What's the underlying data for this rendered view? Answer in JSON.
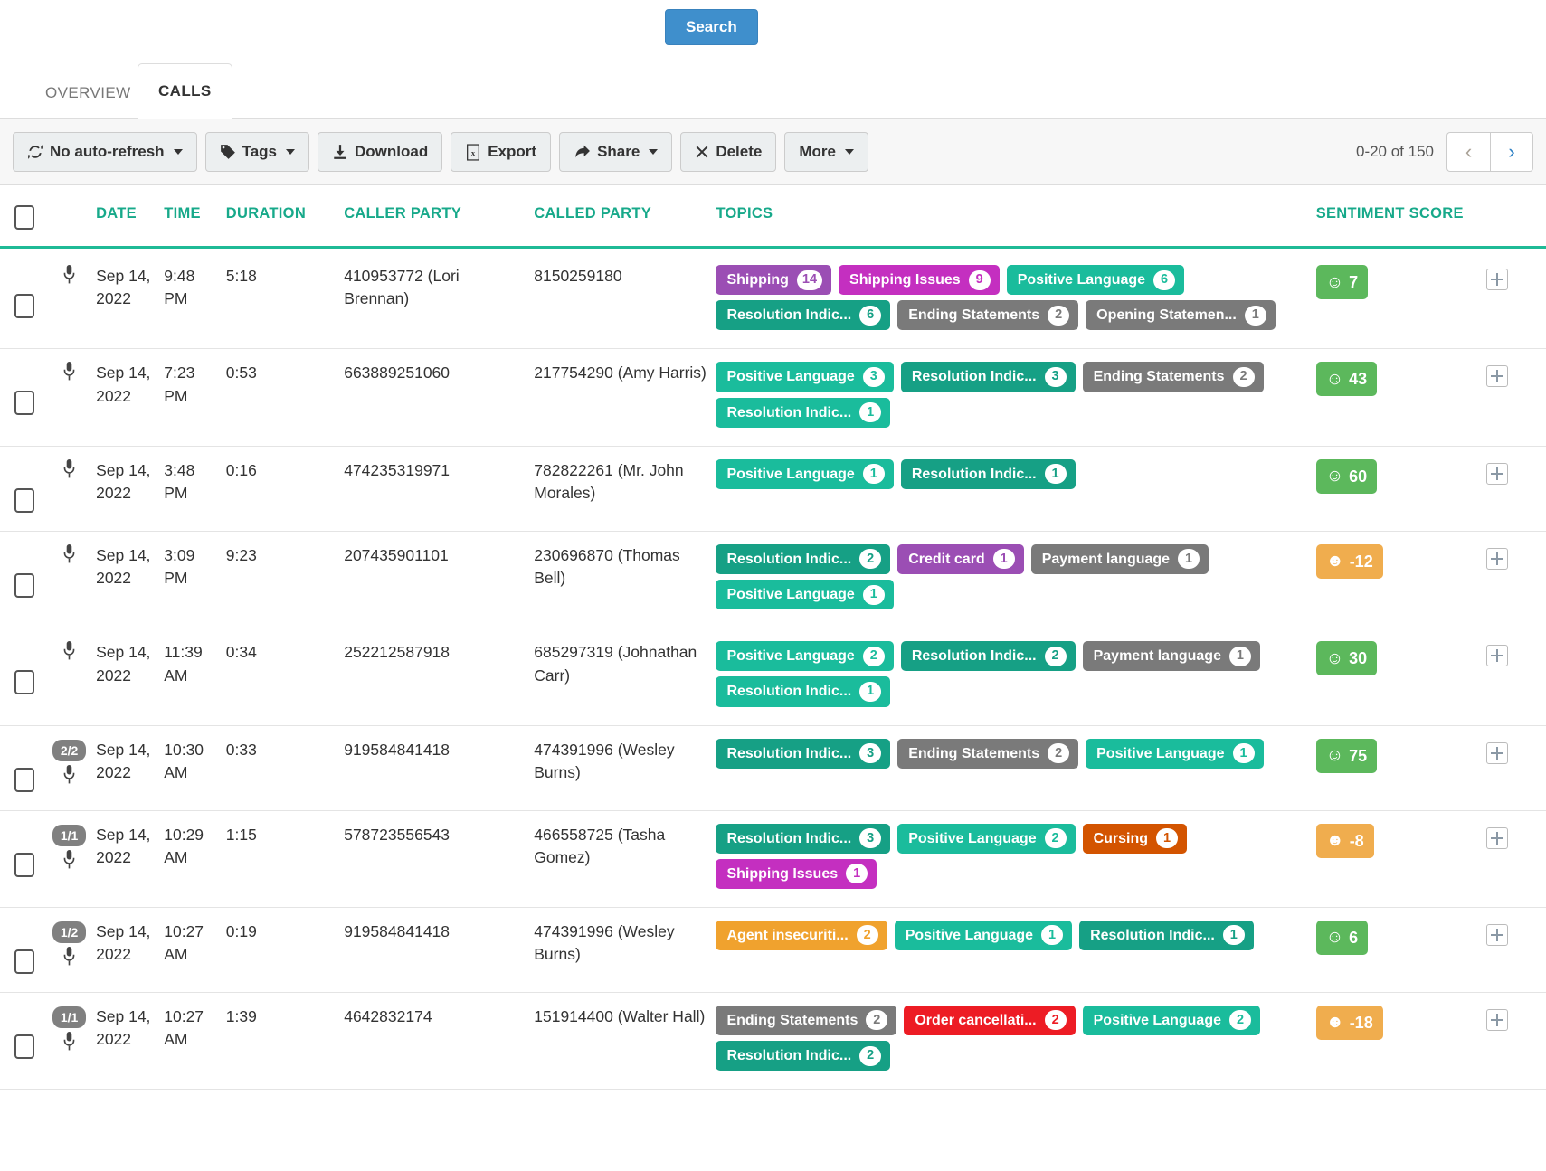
{
  "search": {
    "label": "Search"
  },
  "tabs": [
    {
      "label": "OVERVIEW",
      "active": false
    },
    {
      "label": "CALLS",
      "active": true
    }
  ],
  "toolbar": {
    "buttons": [
      {
        "label": "No auto-refresh",
        "icon": "refresh-icon",
        "caret": true
      },
      {
        "label": "Tags",
        "icon": "tag-icon",
        "caret": true
      },
      {
        "label": "Download",
        "icon": "download-icon",
        "caret": false
      },
      {
        "label": "Export",
        "icon": "spreadsheet-icon",
        "caret": false
      },
      {
        "label": "Share",
        "icon": "share-icon",
        "caret": true
      },
      {
        "label": "Delete",
        "icon": "close-icon",
        "caret": false
      },
      {
        "label": "More",
        "icon": "",
        "caret": true
      }
    ],
    "pagination": {
      "range": "0-20 of 150",
      "prev_icon": "chevron-left-icon",
      "next_icon": "chevron-right-icon"
    }
  },
  "table": {
    "columns": [
      "",
      "",
      "DATE",
      "TIME",
      "DURATION",
      "CALLER PARTY",
      "CALLED PARTY",
      "TOPICS",
      "SENTIMENT SCORE",
      ""
    ],
    "colors": {
      "header": "#17a98a",
      "header_rule": "#1fba96",
      "tag_teal_light": "#1abc9c",
      "tag_teal_dark": "#16a085",
      "tag_gray": "#7a7a7a",
      "tag_purple": "#9b4eb4",
      "tag_magenta": "#c42fc0",
      "tag_orange": "#f0a22e",
      "tag_dark_orange": "#d35400",
      "tag_red": "#ed1c24",
      "sentiment_positive": "#5cb85c",
      "sentiment_negative": "#f0ad4e"
    },
    "rows": [
      {
        "channels": "",
        "mic": "microphone-icon",
        "date": "Sep 14, 2022",
        "time": "9:48 PM",
        "duration": "5:18",
        "caller_party": "410953772 (Lori Brennan)",
        "called_party": "8150259180",
        "topics": [
          {
            "label": "Shipping",
            "count": "14",
            "color": "#9b4eb4",
            "count_color": "#9b4eb4"
          },
          {
            "label": "Shipping Issues",
            "count": "9",
            "color": "#c42fc0",
            "count_color": "#c42fc0"
          },
          {
            "label": "Positive Language",
            "count": "6",
            "color": "#1abc9c",
            "count_color": "#1abc9c"
          },
          {
            "label": "Resolution Indic...",
            "count": "6",
            "color": "#16a085",
            "count_color": "#16a085"
          },
          {
            "label": "Ending Statements",
            "count": "2",
            "color": "#7a7a7a",
            "count_color": "#7a7a7a"
          },
          {
            "label": "Opening Statemen...",
            "count": "1",
            "color": "#7a7a7a",
            "count_color": "#7a7a7a"
          }
        ],
        "sentiment": {
          "value": "7",
          "face": "☺",
          "color": "#5cb85c"
        }
      },
      {
        "channels": "",
        "mic": "microphone-icon",
        "date": "Sep 14, 2022",
        "time": "7:23 PM",
        "duration": "0:53",
        "caller_party": "663889251060",
        "called_party": "217754290 (Amy Harris)",
        "topics": [
          {
            "label": "Positive Language",
            "count": "3",
            "color": "#1abc9c",
            "count_color": "#1abc9c"
          },
          {
            "label": "Resolution Indic...",
            "count": "3",
            "color": "#16a085",
            "count_color": "#16a085"
          },
          {
            "label": "Ending Statements",
            "count": "2",
            "color": "#7a7a7a",
            "count_color": "#7a7a7a"
          },
          {
            "label": "Resolution Indic...",
            "count": "1",
            "color": "#1abc9c",
            "count_color": "#1abc9c"
          }
        ],
        "sentiment": {
          "value": "43",
          "face": "☺",
          "color": "#5cb85c"
        }
      },
      {
        "channels": "",
        "mic": "microphone-icon",
        "date": "Sep 14, 2022",
        "time": "3:48 PM",
        "duration": "0:16",
        "caller_party": "474235319971",
        "called_party": "782822261 (Mr. John Morales)",
        "topics": [
          {
            "label": "Positive Language",
            "count": "1",
            "color": "#1abc9c",
            "count_color": "#1abc9c"
          },
          {
            "label": "Resolution Indic...",
            "count": "1",
            "color": "#16a085",
            "count_color": "#16a085"
          }
        ],
        "sentiment": {
          "value": "60",
          "face": "☺",
          "color": "#5cb85c"
        }
      },
      {
        "channels": "",
        "mic": "microphone-icon",
        "date": "Sep 14, 2022",
        "time": "3:09 PM",
        "duration": "9:23",
        "caller_party": "207435901101",
        "called_party": "230696870 (Thomas Bell)",
        "topics": [
          {
            "label": "Resolution Indic...",
            "count": "2",
            "color": "#16a085",
            "count_color": "#16a085"
          },
          {
            "label": "Credit card",
            "count": "1",
            "color": "#9b4eb4",
            "count_color": "#9b4eb4"
          },
          {
            "label": "Payment language",
            "count": "1",
            "color": "#7a7a7a",
            "count_color": "#7a7a7a"
          },
          {
            "label": "Positive Language",
            "count": "1",
            "color": "#1abc9c",
            "count_color": "#1abc9c"
          }
        ],
        "sentiment": {
          "value": "-12",
          "face": "☻",
          "color": "#f0ad4e"
        }
      },
      {
        "channels": "",
        "mic": "microphone-icon",
        "date": "Sep 14, 2022",
        "time": "11:39 AM",
        "duration": "0:34",
        "caller_party": "252212587918",
        "called_party": "685297319 (Johnathan Carr)",
        "topics": [
          {
            "label": "Positive Language",
            "count": "2",
            "color": "#1abc9c",
            "count_color": "#1abc9c"
          },
          {
            "label": "Resolution Indic...",
            "count": "2",
            "color": "#16a085",
            "count_color": "#16a085"
          },
          {
            "label": "Payment language",
            "count": "1",
            "color": "#7a7a7a",
            "count_color": "#7a7a7a"
          },
          {
            "label": "Resolution Indic...",
            "count": "1",
            "color": "#1abc9c",
            "count_color": "#1abc9c"
          }
        ],
        "sentiment": {
          "value": "30",
          "face": "☺",
          "color": "#5cb85c"
        }
      },
      {
        "channels": "2/2",
        "mic": "microphone-icon",
        "date": "Sep 14, 2022",
        "time": "10:30 AM",
        "duration": "0:33",
        "caller_party": "919584841418",
        "called_party": "474391996 (Wesley Burns)",
        "topics": [
          {
            "label": "Resolution Indic...",
            "count": "3",
            "color": "#16a085",
            "count_color": "#16a085"
          },
          {
            "label": "Ending Statements",
            "count": "2",
            "color": "#7a7a7a",
            "count_color": "#7a7a7a"
          },
          {
            "label": "Positive Language",
            "count": "1",
            "color": "#1abc9c",
            "count_color": "#1abc9c"
          }
        ],
        "sentiment": {
          "value": "75",
          "face": "☺",
          "color": "#5cb85c"
        }
      },
      {
        "channels": "1/1",
        "mic": "microphone-icon",
        "date": "Sep 14, 2022",
        "time": "10:29 AM",
        "duration": "1:15",
        "caller_party": "578723556543",
        "called_party": "466558725 (Tasha Gomez)",
        "topics": [
          {
            "label": "Resolution Indic...",
            "count": "3",
            "color": "#16a085",
            "count_color": "#16a085"
          },
          {
            "label": "Positive Language",
            "count": "2",
            "color": "#1abc9c",
            "count_color": "#1abc9c"
          },
          {
            "label": "Cursing",
            "count": "1",
            "color": "#d35400",
            "count_color": "#d35400"
          },
          {
            "label": "Shipping Issues",
            "count": "1",
            "color": "#c42fc0",
            "count_color": "#c42fc0"
          }
        ],
        "sentiment": {
          "value": "-8",
          "face": "☻",
          "color": "#f0ad4e"
        }
      },
      {
        "channels": "1/2",
        "mic": "microphone-icon",
        "date": "Sep 14, 2022",
        "time": "10:27 AM",
        "duration": "0:19",
        "caller_party": "919584841418",
        "called_party": "474391996 (Wesley Burns)",
        "topics": [
          {
            "label": "Agent insecuriti...",
            "count": "2",
            "color": "#f0a22e",
            "count_color": "#f0a22e"
          },
          {
            "label": "Positive Language",
            "count": "1",
            "color": "#1abc9c",
            "count_color": "#1abc9c"
          },
          {
            "label": "Resolution Indic...",
            "count": "1",
            "color": "#16a085",
            "count_color": "#16a085"
          }
        ],
        "sentiment": {
          "value": "6",
          "face": "☺",
          "color": "#5cb85c"
        }
      },
      {
        "channels": "1/1",
        "mic": "microphone-icon",
        "date": "Sep 14, 2022",
        "time": "10:27 AM",
        "duration": "1:39",
        "caller_party": "4642832174",
        "called_party": "151914400 (Walter Hall)",
        "topics": [
          {
            "label": "Ending Statements",
            "count": "2",
            "color": "#7a7a7a",
            "count_color": "#7a7a7a"
          },
          {
            "label": "Order cancellati...",
            "count": "2",
            "color": "#ed1c24",
            "count_color": "#ed1c24"
          },
          {
            "label": "Positive Language",
            "count": "2",
            "color": "#1abc9c",
            "count_color": "#1abc9c"
          },
          {
            "label": "Resolution Indic...",
            "count": "2",
            "color": "#16a085",
            "count_color": "#16a085"
          }
        ],
        "sentiment": {
          "value": "-18",
          "face": "☻",
          "color": "#f0ad4e"
        }
      }
    ]
  }
}
